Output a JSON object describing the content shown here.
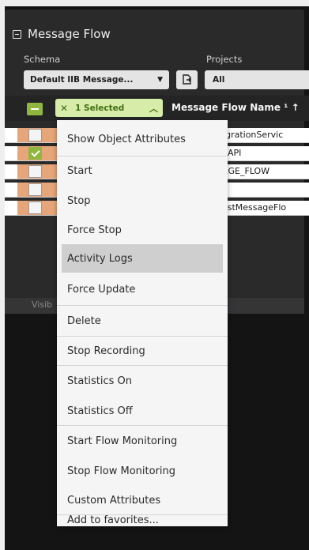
{
  "panel": {
    "title": "Message Flow",
    "schema_label": "Schema",
    "schema_value": "Default IIB Message...",
    "projects_label": "Projects",
    "projects_value": "All"
  },
  "table": {
    "selection_count": "1 Selected",
    "column_header": "Message Flow Name ¹ ↑",
    "rows": [
      {
        "text": "tegrationServic",
        "checked": false
      },
      {
        "text": "eRAPI",
        "checked": true
      },
      {
        "text": "SAGE_FLOW",
        "checked": false
      },
      {
        "text": "",
        "checked": false
      },
      {
        "text": "uestMessageFlo",
        "checked": false
      }
    ],
    "visible_text": "Visib"
  },
  "context_menu": {
    "items": [
      "Show Object Attributes",
      "Start",
      "Stop",
      "Force Stop",
      "Activity Logs",
      "Force Update",
      "Delete",
      "Stop Recording",
      "Statistics On",
      "Statistics Off",
      "Start Flow Monitoring",
      "Stop Flow Monitoring",
      "Custom Attributes",
      "Add to favorites..."
    ],
    "highlighted": "Activity Logs"
  },
  "colors": {
    "accent_green": "#8fb63e",
    "pill_bg": "#d8ecaa",
    "row_stripe": "#e6a67a",
    "dark_bg": "#141414"
  }
}
